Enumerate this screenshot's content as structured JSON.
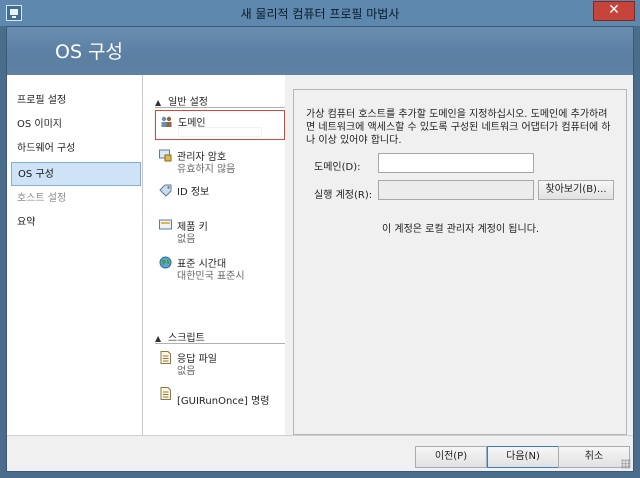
{
  "window": {
    "title": "새 물리적 컴퓨터 프로필 마법사",
    "close_label": "✕"
  },
  "banner": {
    "title": "OS 구성"
  },
  "nav": {
    "items": [
      {
        "label": "프로필 설정",
        "state": "normal"
      },
      {
        "label": "OS 이미지",
        "state": "normal"
      },
      {
        "label": "하드웨어 구성",
        "state": "normal"
      },
      {
        "label": "OS 구성",
        "state": "selected"
      },
      {
        "label": "호스트 설정",
        "state": "disabled"
      },
      {
        "label": "요약",
        "state": "normal"
      }
    ]
  },
  "settings": {
    "general_header": "일반 설정",
    "items": [
      {
        "title": "도메인",
        "sub": "",
        "icon": "domain-icon"
      },
      {
        "title": "관리자 암호",
        "sub": "유효하지 않음",
        "icon": "admin-password-icon"
      },
      {
        "title": "ID 정보",
        "sub": "",
        "icon": "id-tag-icon"
      },
      {
        "title": "제품 키",
        "sub": "없음",
        "icon": "product-key-icon"
      },
      {
        "title": "표준 시간대",
        "sub": "대한민국 표준시",
        "icon": "timezone-globe-icon"
      }
    ],
    "scripts_header": "스크립트",
    "script_items": [
      {
        "title": "응답 파일",
        "sub": "없음",
        "icon": "answer-file-icon"
      },
      {
        "title": "[GUIRunOnce] 명령",
        "sub": "",
        "icon": "command-file-icon"
      }
    ]
  },
  "content": {
    "description": "가상 컴퓨터 호스트를 추가할 도메인을 지정하십시오. 도메인에 추가하려면 네트워크에 액세스할 수 있도록 구성된 네트워크 어댑터가 컴퓨터에 하나 이상 있어야 합니다.",
    "domain_label": "도메인(D):",
    "domain_value": "",
    "run_as_label": "실행 계정(R):",
    "run_as_value": "",
    "browse_label": "찾아보기(B)...",
    "hint": "이 계정은 로컬 관리자 계정이 됩니다."
  },
  "footer": {
    "prev_label": "이전(P)",
    "next_label": "다음(N)",
    "cancel_label": "취소"
  }
}
